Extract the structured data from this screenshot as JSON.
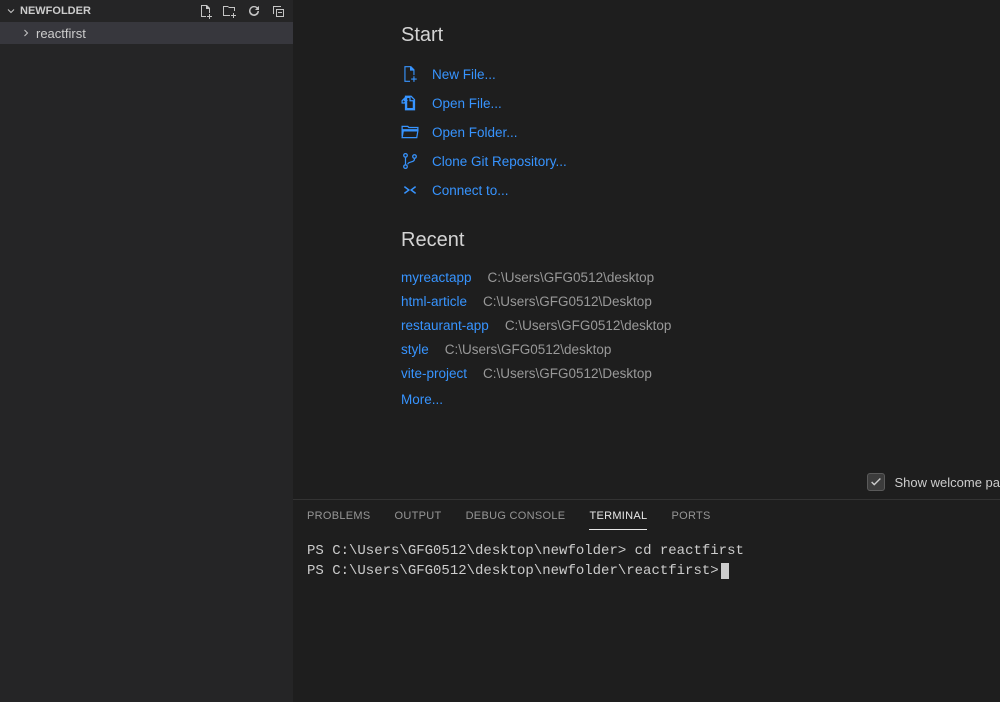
{
  "sidebar": {
    "folder_name": "NEWFOLDER",
    "tree": {
      "item0": "reactfirst"
    }
  },
  "start": {
    "heading": "Start",
    "items": [
      {
        "label": "New File..."
      },
      {
        "label": "Open File..."
      },
      {
        "label": "Open Folder..."
      },
      {
        "label": "Clone Git Repository..."
      },
      {
        "label": "Connect to..."
      }
    ]
  },
  "recent": {
    "heading": "Recent",
    "items": [
      {
        "name": "myreactapp",
        "path": "C:\\Users\\GFG0512\\desktop"
      },
      {
        "name": "html-article",
        "path": "C:\\Users\\GFG0512\\Desktop"
      },
      {
        "name": "restaurant-app",
        "path": "C:\\Users\\GFG0512\\desktop"
      },
      {
        "name": "style",
        "path": "C:\\Users\\GFG0512\\desktop"
      },
      {
        "name": "vite-project",
        "path": "C:\\Users\\GFG0512\\Desktop"
      }
    ],
    "more": "More..."
  },
  "welcome_checkbox_label": "Show welcome pa",
  "panel": {
    "tabs": {
      "problems": "PROBLEMS",
      "output": "OUTPUT",
      "debug_console": "DEBUG CONSOLE",
      "terminal": "TERMINAL",
      "ports": "PORTS"
    },
    "terminal_lines": {
      "l0_prompt": "PS C:\\Users\\GFG0512\\desktop\\newfolder>",
      "l0_cmd": " cd reactfirst",
      "l1_prompt": "PS C:\\Users\\GFG0512\\desktop\\newfolder\\reactfirst>"
    }
  }
}
